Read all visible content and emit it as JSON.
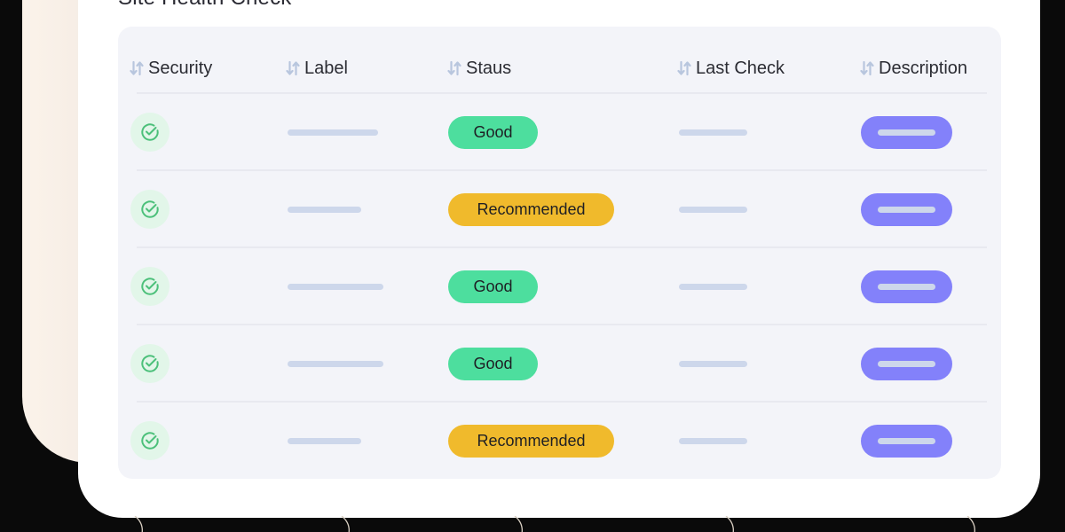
{
  "page": {
    "title": "Site Health Check"
  },
  "colors": {
    "background": "#0a0a0a",
    "card": "#ffffff",
    "table_panel": "#f3f4f9",
    "good": "#4dde9e",
    "recommended": "#f0ba2c",
    "description_button": "#8381fa",
    "placeholder": "#cdd7eb",
    "check_icon": "#4cc07a",
    "check_badge_bg": "#e2f6e9",
    "sort_icon": "#b8c6de"
  },
  "table": {
    "columns": [
      {
        "label": "Security",
        "icon": "sort-icon"
      },
      {
        "label": "Label",
        "icon": "sort-icon"
      },
      {
        "label": "Staus",
        "icon": "sort-icon"
      },
      {
        "label": "Last Check",
        "icon": "sort-icon"
      },
      {
        "label": "Description",
        "icon": "sort-icon"
      }
    ],
    "rows": [
      {
        "security_icon": "check-circle-icon",
        "label": "",
        "status": "Good",
        "status_type": "good",
        "last_check": "",
        "description": ""
      },
      {
        "security_icon": "check-circle-icon",
        "label": "",
        "status": "Recommended",
        "status_type": "recommended",
        "last_check": "",
        "description": ""
      },
      {
        "security_icon": "check-circle-icon",
        "label": "",
        "status": "Good",
        "status_type": "good",
        "last_check": "",
        "description": ""
      },
      {
        "security_icon": "check-circle-icon",
        "label": "",
        "status": "Good",
        "status_type": "good",
        "last_check": "",
        "description": ""
      },
      {
        "security_icon": "check-circle-icon",
        "label": "",
        "status": "Recommended",
        "status_type": "recommended",
        "last_check": "",
        "description": ""
      }
    ]
  }
}
